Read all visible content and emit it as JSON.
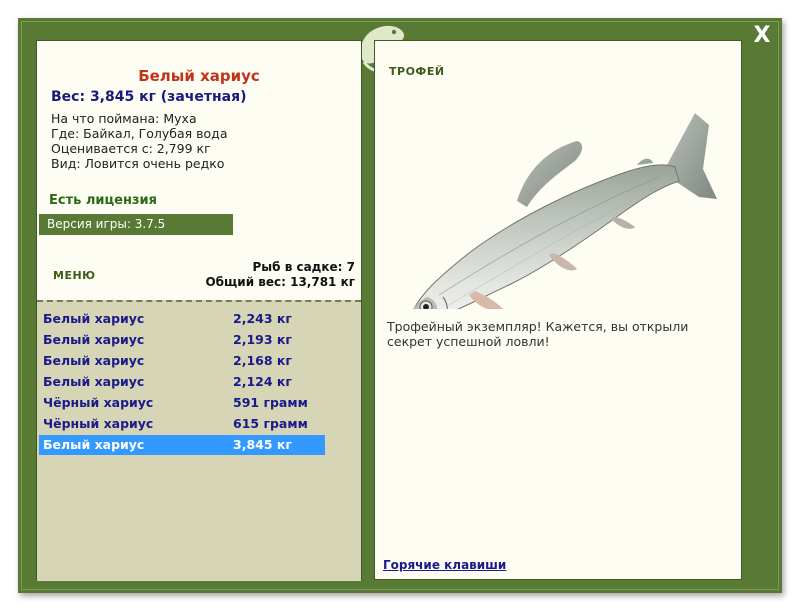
{
  "window": {
    "close_label": "X"
  },
  "fish_info": {
    "title": "Белый хариус",
    "weight": "Вес: 3,845 кг (зачетная)",
    "bait": "На что поймана: Муха",
    "place": "Где: Байкал, Голубая вода",
    "valued": "Оценивается с: 2,799 кг",
    "kind": "Вид: Ловится очень редко"
  },
  "license": "Есть лицензия",
  "version": "Версия игры: 3.7.5",
  "menu_label": "МЕНЮ",
  "stats": {
    "count": "Рыб в садке: 7",
    "total": "Общий вес: 13,781 кг"
  },
  "catch_list": [
    {
      "name": "Белый хариус",
      "weight": "2,243 кг"
    },
    {
      "name": "Белый хариус",
      "weight": "2,193 кг"
    },
    {
      "name": "Белый хариус",
      "weight": "2,168 кг"
    },
    {
      "name": "Белый хариус",
      "weight": "2,124 кг"
    },
    {
      "name": "Чёрный хариус",
      "weight": "591 грамм"
    },
    {
      "name": "Чёрный хариус",
      "weight": "615 грамм"
    },
    {
      "name": "Белый хариус",
      "weight": "3,845 кг",
      "selected": true
    }
  ],
  "trophy": {
    "label": "ТРОФЕЙ",
    "description": "Трофейный экземпляр! Кажется, вы открыли секрет успешной ловли!"
  },
  "hotkeys": "Горячие клавиши",
  "colors": {
    "frame": "#597a35",
    "panel": "#fdfdf4",
    "list_bg": "#d6d6b6",
    "selection": "#3399ff",
    "title": "#c0341a"
  }
}
